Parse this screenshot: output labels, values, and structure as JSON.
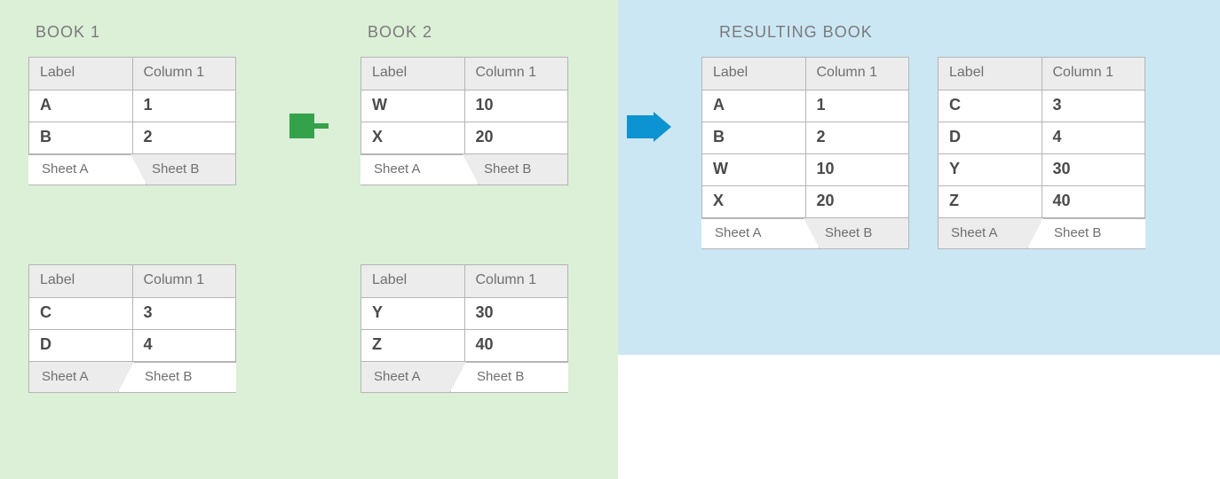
{
  "titles": {
    "book1": "BOOK 1",
    "book2": "BOOK 2",
    "result": "RESULTING BOOK"
  },
  "headers": {
    "label": "Label",
    "col1": "Column 1"
  },
  "tabs": {
    "a": "Sheet A",
    "b": "Sheet B"
  },
  "book1": {
    "sheetA": [
      {
        "label": "A",
        "val": "1"
      },
      {
        "label": "B",
        "val": "2"
      }
    ],
    "sheetB": [
      {
        "label": "C",
        "val": "3"
      },
      {
        "label": "D",
        "val": "4"
      }
    ]
  },
  "book2": {
    "sheetA": [
      {
        "label": "W",
        "val": "10"
      },
      {
        "label": "X",
        "val": "20"
      }
    ],
    "sheetB": [
      {
        "label": "Y",
        "val": "30"
      },
      {
        "label": "Z",
        "val": "40"
      }
    ]
  },
  "result": {
    "sheetA": [
      {
        "label": "A",
        "val": "1"
      },
      {
        "label": "B",
        "val": "2"
      },
      {
        "label": "W",
        "val": "10"
      },
      {
        "label": "X",
        "val": "20"
      }
    ],
    "sheetB": [
      {
        "label": "C",
        "val": "3"
      },
      {
        "label": "D",
        "val": "4"
      },
      {
        "label": "Y",
        "val": "30"
      },
      {
        "label": "Z",
        "val": "40"
      }
    ]
  },
  "icons": {
    "combine": "combine-icon",
    "arrow": "arrow-right-icon"
  }
}
